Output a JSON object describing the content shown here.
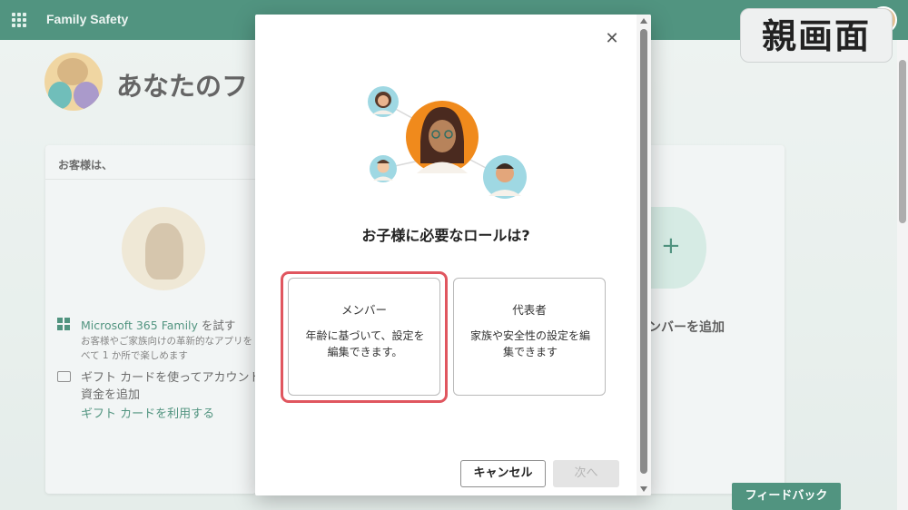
{
  "app": {
    "title": "Family Safety"
  },
  "overlay_label": "親画面",
  "background": {
    "heading": "あなたのフ",
    "left_card": {
      "header": "お客様は、",
      "microsoft365": {
        "title": "Microsoft 365 Family",
        "title_suffix": " を試す",
        "description": "お客様やご家族向けの革新的なアプリを\nべて 1 か所で楽しめます"
      },
      "gift": {
        "title": "ギフト カードを使ってアカウント\n資金を追加",
        "link": "ギフト カードを利用する"
      }
    },
    "right_card": {
      "add_member": "ンバーを追加",
      "add_symbol": "+"
    },
    "feedback_label": "フィードバック"
  },
  "dialog": {
    "close_symbol": "✕",
    "heading": "お子様に必要なロールは?",
    "roles": [
      {
        "title": "メンバー",
        "description": "年齢に基づいて、設定を編集できます。"
      },
      {
        "title": "代表者",
        "description": "家族や安全性の設定を編集できます"
      }
    ],
    "cancel_label": "キャンセル",
    "next_label": "次へ"
  },
  "colors": {
    "brand": "#0f6b4f",
    "highlight": "#e0565f",
    "orange_avatar": "#f08a1c",
    "teal_avatar": "#9fd8e3"
  }
}
